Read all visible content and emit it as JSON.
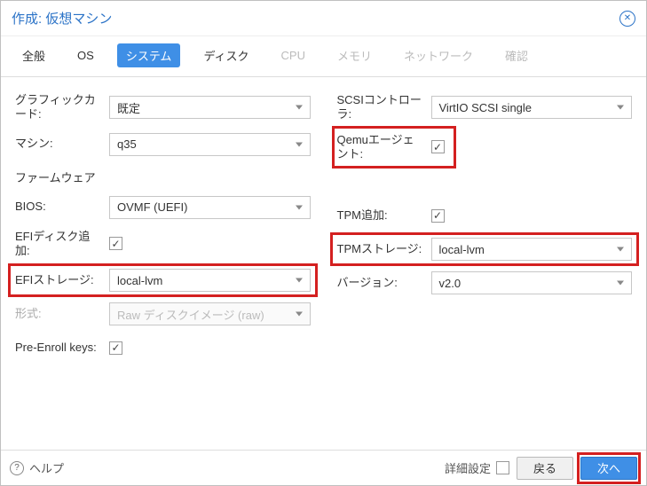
{
  "title": "作成: 仮想マシン",
  "tabs": {
    "general": "全般",
    "os": "OS",
    "system": "システム",
    "disk": "ディスク",
    "cpu": "CPU",
    "memory": "メモリ",
    "network": "ネットワーク",
    "confirm": "確認"
  },
  "left": {
    "graphic_label": "グラフィックカード:",
    "graphic_value": "既定",
    "machine_label": "マシン:",
    "machine_value": "q35",
    "firmware_label": "ファームウェア",
    "bios_label": "BIOS:",
    "bios_value": "OVMF (UEFI)",
    "efidisk_label": "EFIディスク追加:",
    "efistorage_label": "EFIストレージ:",
    "efistorage_value": "local-lvm",
    "format_label": "形式:",
    "format_value": "Raw ディスクイメージ (raw)",
    "preenroll_label": "Pre-Enroll keys:"
  },
  "right": {
    "scsi_label": "SCSIコントローラ:",
    "scsi_value": "VirtIO SCSI single",
    "qemu_label": "Qemuエージェント:",
    "tpm_add_label": "TPM追加:",
    "tpm_storage_label": "TPMストレージ:",
    "tpm_storage_value": "local-lvm",
    "version_label": "バージョン:",
    "version_value": "v2.0"
  },
  "footer": {
    "help": "ヘルプ",
    "advanced": "詳細設定",
    "back": "戻る",
    "next": "次へ"
  }
}
